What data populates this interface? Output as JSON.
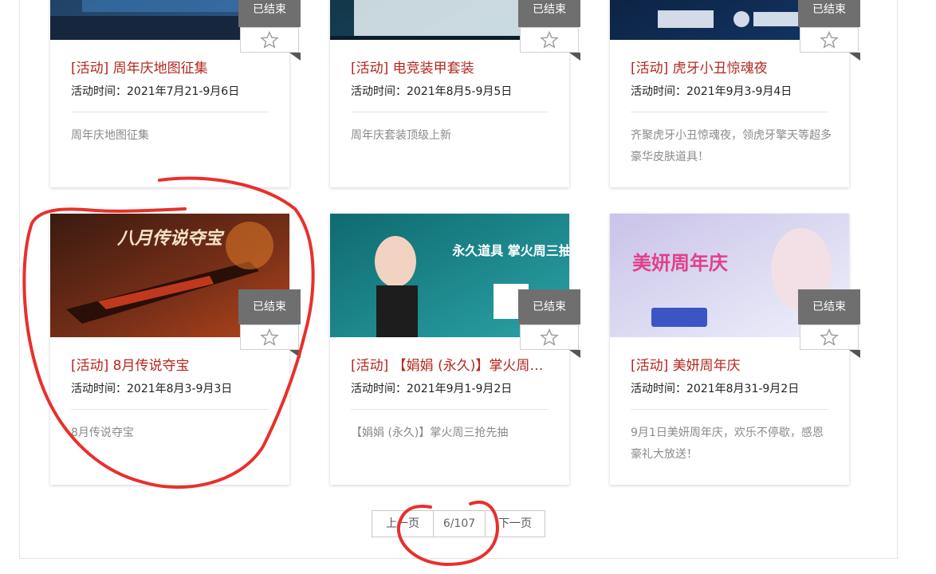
{
  "colors": {
    "title": "#b3281e",
    "badge": "#6f6f6f",
    "annotation": "#e8302c"
  },
  "cards": [
    {
      "title": "[活动] 周年庆地图征集",
      "time": "活动时间：2021年7月21-9月6日",
      "desc": "周年庆地图征集",
      "status": "已结束",
      "banner_text": "",
      "banner_colors": [
        "#1c3552",
        "#2d5a8a"
      ]
    },
    {
      "title": "[活动] 电竞装甲套装",
      "time": "活动时间：2021年8月5-9月5日",
      "desc": "周年庆套装顶级上新",
      "status": "已结束",
      "banner_text": "",
      "banner_colors": [
        "#0e2a3a",
        "#1b4e66"
      ]
    },
    {
      "title": "[活动] 虎牙小丑惊魂夜",
      "time": "活动时间：2021年9月3-9月4日",
      "desc": "齐聚虎牙小丑惊魂夜，领虎牙擎天等超多豪华皮肤道具！",
      "status": "已结束",
      "banner_text": "",
      "banner_colors": [
        "#0b1a33",
        "#123566"
      ]
    },
    {
      "title": "[活动] 8月传说夺宝",
      "time": "活动时间：2021年8月3-9月3日",
      "desc": "8月传说夺宝",
      "status": "已结束",
      "banner_text": "八月传说夺宝",
      "banner_colors": [
        "#3a1a10",
        "#b5451c"
      ]
    },
    {
      "title": "[活动] 【娟娟 (永久)】掌火周三抢先抽",
      "time": "活动时间：2021年9月1-9月2日",
      "desc": "【娟娟 (永久)】掌火周三抢先抽",
      "status": "已结束",
      "banner_text": "永久道具 掌火周三抽",
      "banner_colors": [
        "#0f6a70",
        "#2aa2a6"
      ]
    },
    {
      "title": "[活动] 美妍周年庆",
      "time": "活动时间：2021年8月31-9月2日",
      "desc": "9月1日美妍周年庆，欢乐不停歇，感恩豪礼大放送！",
      "status": "已结束",
      "banner_text": "美妍周年庆",
      "banner_colors": [
        "#c9c3e8",
        "#eef0fb"
      ]
    }
  ],
  "pager": {
    "prev": "上一页",
    "current": "6/107",
    "next": "下一页"
  }
}
